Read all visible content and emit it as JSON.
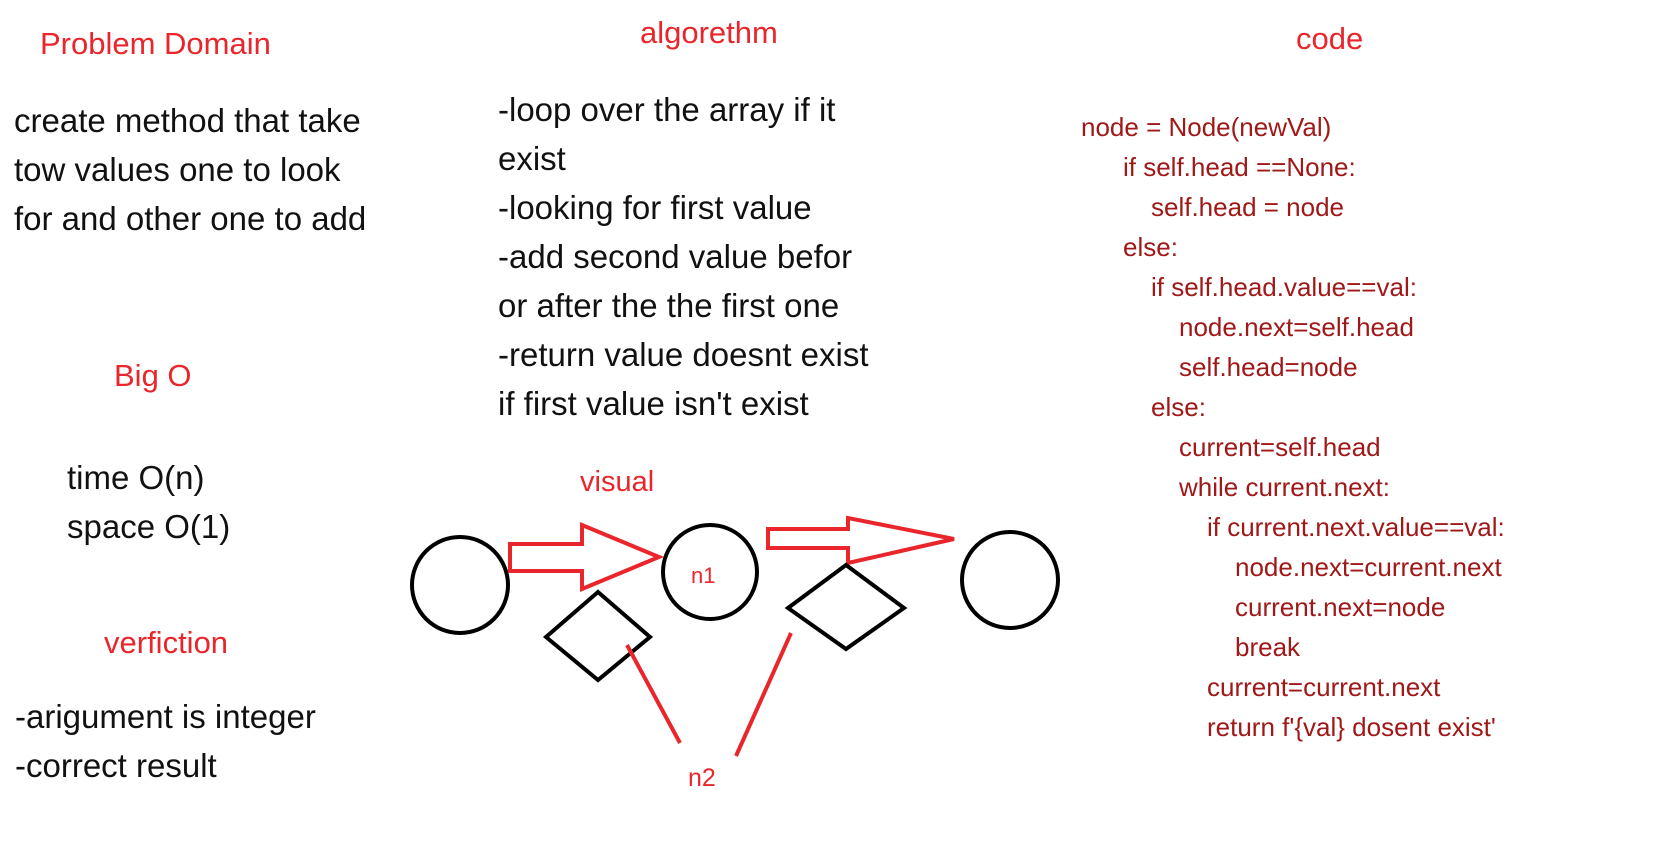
{
  "headings": {
    "problem_domain": "Problem Domain",
    "algorithm": "algorethm",
    "code": "code",
    "big_o": "Big O",
    "verification": "verfiction",
    "visual": "visual"
  },
  "problem_domain": {
    "lines": [
      "create method that take",
      "tow values one to look",
      "for and other one to add"
    ]
  },
  "algorithm": {
    "lines": [
      "-loop over the array if it",
      "exist",
      "-looking for first value",
      "-add second value befor",
      "or after the the first one",
      "-return value doesnt exist",
      "if first value isn't exist"
    ]
  },
  "big_o": {
    "lines": [
      "time O(n)",
      "space O(1)"
    ]
  },
  "verification": {
    "lines": [
      "-arigument is integer",
      "-correct result"
    ]
  },
  "code": {
    "lines": [
      "node = Node(newVal)",
      "if self.head ==None:",
      "self.head = node",
      "else:",
      "if self.head.value==val:",
      "node.next=self.head",
      "self.head=node",
      "else:",
      "current=self.head",
      "while current.next:",
      "if current.next.value==val:",
      "node.next=current.next",
      "current.next=node",
      "break",
      "current=current.next",
      "return f'{val} dosent exist'"
    ]
  },
  "visual": {
    "n1_label": "n1",
    "n2_label": "n2"
  },
  "colors": {
    "heading": "#e8262b",
    "code": "#a01818",
    "text": "#111111",
    "arrow": "#e8262b",
    "shape_stroke": "#000000"
  }
}
